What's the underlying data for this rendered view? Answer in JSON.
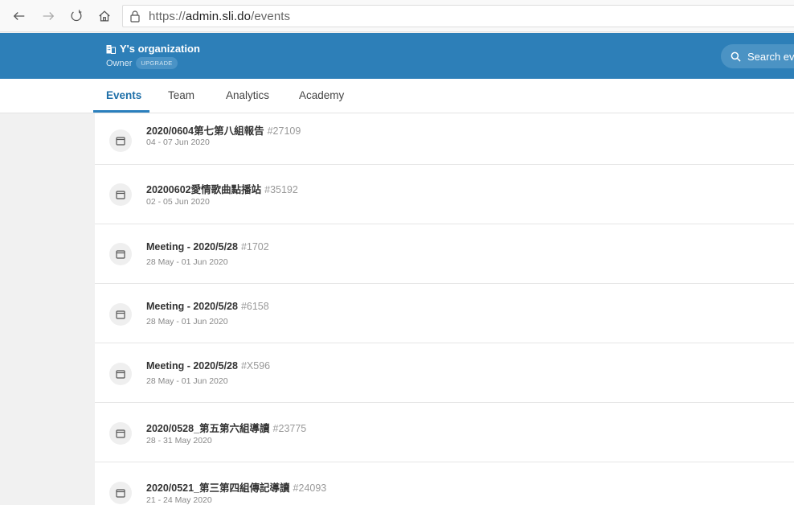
{
  "browser": {
    "url_scheme": "https://",
    "url_host": "admin.sli.do",
    "url_path": "/events"
  },
  "header": {
    "org_name": "Y's organization",
    "role": "Owner",
    "upgrade_label": "UPGRADE",
    "search_text": "Search ev"
  },
  "tabs": [
    {
      "label": "Events",
      "active": true
    },
    {
      "label": "Team",
      "active": false
    },
    {
      "label": "Analytics",
      "active": false
    },
    {
      "label": "Academy",
      "active": false
    }
  ],
  "events": [
    {
      "title": "2020/0604第七第八組報告",
      "code": "#27109",
      "dates": "04 - 07 Jun 2020"
    },
    {
      "title": "20200602愛情歌曲點播站",
      "code": "#35192",
      "dates": "02 - 05 Jun 2020"
    },
    {
      "title": "Meeting - 2020/5/28",
      "code": "#1702",
      "dates": "28 May - 01 Jun 2020"
    },
    {
      "title": "Meeting - 2020/5/28",
      "code": "#6158",
      "dates": "28 May - 01 Jun 2020"
    },
    {
      "title": "Meeting - 2020/5/28",
      "code": "#X596",
      "dates": "28 May - 01 Jun 2020"
    },
    {
      "title": "2020/0528_第五第六組導讀",
      "code": "#23775",
      "dates": "28 - 31 May 2020"
    },
    {
      "title": "2020/0521_第三第四組傳記導讀",
      "code": "#24093",
      "dates": "21 - 24 May 2020"
    }
  ],
  "colors": {
    "brand": "#2d7fb8",
    "active_tab": "#1e6fa8"
  }
}
